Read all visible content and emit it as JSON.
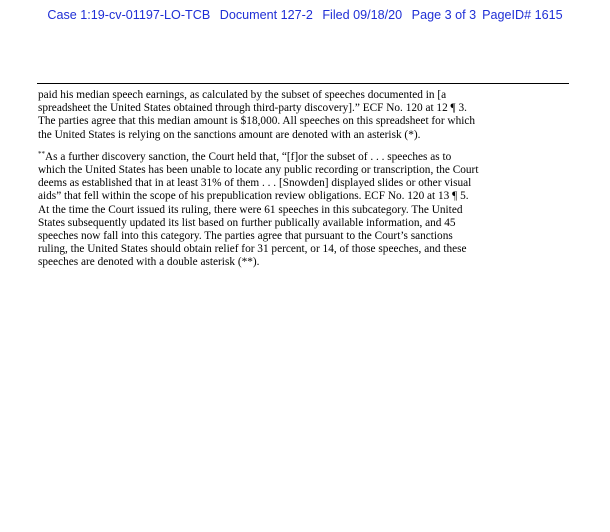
{
  "header": {
    "case_number": "Case 1:19-cv-01197-LO-TCB",
    "document": "Document 127-2",
    "filed": "Filed 09/18/20",
    "page": "Page 3 of 3",
    "page_id": "PageID# 1615"
  },
  "footnotes": [
    {
      "marker": "",
      "lines": [
        "paid his median speech earnings, as calculated by the subset of speeches documented in [a",
        "spreadsheet the United States obtained through third-party discovery].” ECF No. 120 at 12 ¶ 3.",
        "The parties agree that this median amount is $18,000.  All speeches on this spreadsheet for which",
        "the United States is relying on the sanctions amount are denoted with an asterisk (*)."
      ]
    },
    {
      "marker": "**",
      "lines": [
        "As a further discovery sanction, the Court held that, “[f]or the subset of . . . speeches as to",
        "which the United States has been unable to locate any public recording or transcription, the Court",
        "deems as established that in at least 31% of them . . . [Snowden] displayed slides or other visual",
        "aids” that fell within the scope of his prepublication review obligations.  ECF No. 120 at 13 ¶ 5.",
        "At the time the Court issued its ruling, there were 61 speeches in this subcategory.  The United",
        "States subsequently updated its list based on further publically available information, and 45",
        "speeches now fall into this category.  The parties agree that pursuant to the Court’s sanctions",
        "ruling, the United States should obtain relief for 31 percent, or 14, of those speeches, and these",
        "speeches are denoted with a double asterisk (**)."
      ]
    }
  ]
}
